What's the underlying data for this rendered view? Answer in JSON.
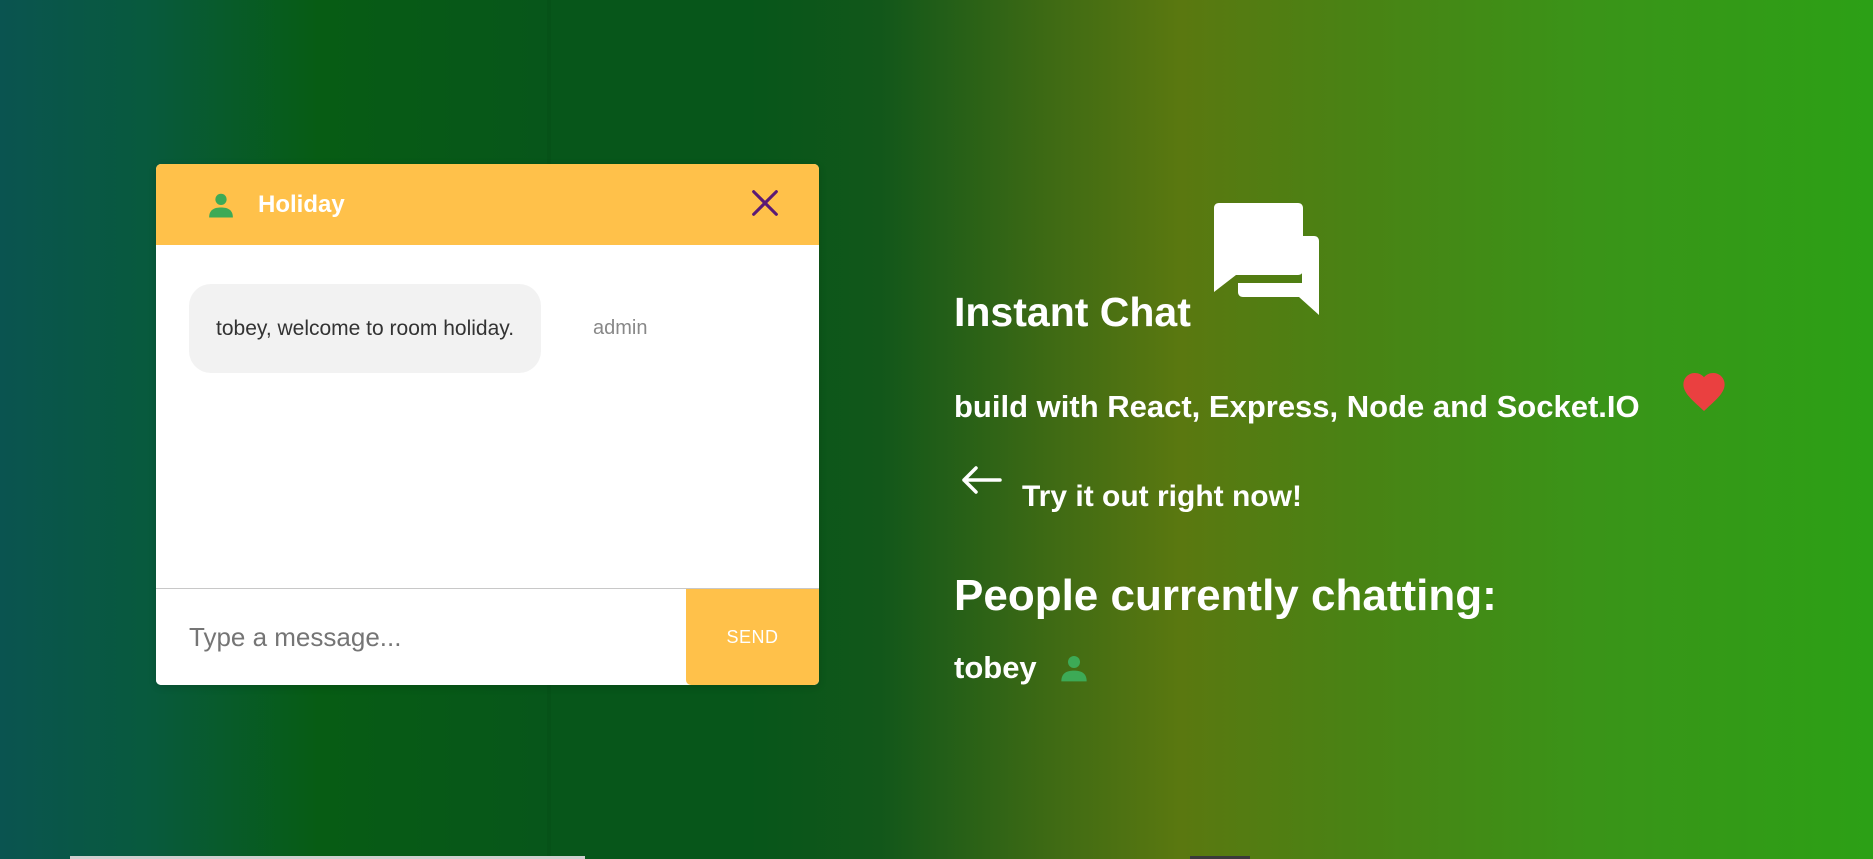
{
  "chat_window": {
    "room_name": "Holiday",
    "messages": [
      {
        "text": "tobey, welcome to room holiday.",
        "sender": "admin"
      }
    ],
    "input_placeholder": "Type a message...",
    "send_label": "SEND"
  },
  "info_panel": {
    "title": "Instant Chat",
    "subtitle": "build with React, Express, Node and Socket.IO",
    "call_to_action": "Try it out right now!",
    "people_heading": "People currently chatting:",
    "people": [
      "tobey"
    ]
  },
  "icons": {
    "header_user": "person-icon",
    "close": "close-icon",
    "chat": "chat-bubbles-icon",
    "heart": "heart-icon",
    "arrow": "arrow-left-icon",
    "person": "person-icon"
  },
  "colors": {
    "accent_yellow": "#ffc14a",
    "user_icon_green": "#3daa56",
    "close_purple": "#5b1a75",
    "heart_red": "#ea4040",
    "bubble_gray": "#f2f2f2"
  }
}
